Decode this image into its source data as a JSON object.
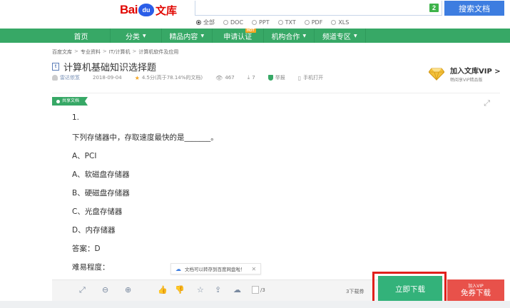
{
  "logo": {
    "bai": "Bai",
    "du": "du",
    "wenku": "文库"
  },
  "search": {
    "badge": "2",
    "button_label": "搜索文档",
    "filters": [
      {
        "label": "全部",
        "selected": true
      },
      {
        "label": "DOC",
        "selected": false
      },
      {
        "label": "PPT",
        "selected": false
      },
      {
        "label": "TXT",
        "selected": false
      },
      {
        "label": "PDF",
        "selected": false
      },
      {
        "label": "XLS",
        "selected": false
      }
    ]
  },
  "nav": {
    "items": [
      {
        "label": "首页"
      },
      {
        "label": "分类"
      },
      {
        "label": "精品内容"
      },
      {
        "label": "申请认证",
        "badge": "HOT"
      },
      {
        "label": "机构合作"
      },
      {
        "label": "频道专区"
      }
    ]
  },
  "breadcrumb": [
    "百度文库",
    "专业资料",
    "IT/计算机",
    "计算机软件及应用"
  ],
  "doc": {
    "type_icon": "t",
    "title": "计算机基础知识选择题",
    "author": "雷达侬笈",
    "date": "2018-09-04",
    "rating": "4.5分(高于78.14%的文档)",
    "views": "467",
    "downloads": "7",
    "report": "举报",
    "mobile": "手机打开"
  },
  "vip_banner": {
    "title": "加入文库VIP >",
    "subtitle": "畅阅享VIP精品版"
  },
  "share_tag": "共享文档",
  "content_lines": [
    "1.",
    "下列存储器中，存取速度最快的是_______。",
    "A、PCI",
    "A、软磁盘存储器",
    "B、硬磁盘存储器",
    "C、光盘存储器",
    "D、内存储器",
    "答案：D",
    "难易程度："
  ],
  "toast": {
    "text": "文档可以转存到百度网盘啦！"
  },
  "toolbar": {
    "page_total": "/3",
    "coupons": "3下载券",
    "download_label": "立即下载",
    "vip_top": "加入VIP",
    "vip_bottom": "免券下载"
  },
  "colors": {
    "nav_green": "#37a866",
    "search_blue": "#3d7de0",
    "download_green": "#33b27a",
    "vip_red": "#e8514a",
    "highlight": "#e1201c"
  }
}
